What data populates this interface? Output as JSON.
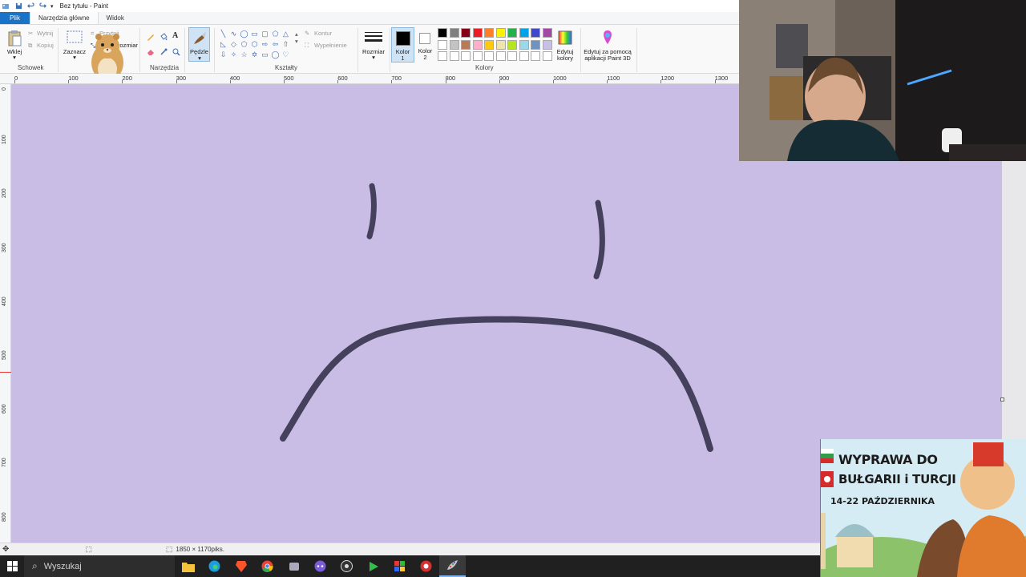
{
  "window": {
    "title": "Bez tytułu - Paint"
  },
  "menu": {
    "file": "Plik",
    "tabs": [
      "Narzędzia główne",
      "Widok"
    ]
  },
  "ribbon": {
    "clipboard": {
      "paste": "Wklej",
      "cut": "Wytnij",
      "copy": "Kopiuj",
      "group": "Schowek"
    },
    "image": {
      "select": "Zaznacz",
      "crop": "Przytnij",
      "resize": "Zmień rozmiar",
      "rotate": "Obróć"
    },
    "tools": {
      "group": "Narzędzia"
    },
    "brushes": {
      "label": "Pędzle"
    },
    "shapes": {
      "outline": "Kontur",
      "fill": "Wypełnienie",
      "group": "Kształty"
    },
    "size": {
      "label": "Rozmiar"
    },
    "colors": {
      "color1_line1": "Kolor",
      "color1_line2": "1",
      "color2_line1": "Kolor",
      "color2_line2": "2",
      "edit_line1": "Edytuj",
      "edit_line2": "kolory",
      "paint3d_line1": "Edytuj za pomocą",
      "paint3d_line2": "aplikacji Paint 3D",
      "group": "Kolory",
      "palette_row1": [
        "#000000",
        "#7f7f7f",
        "#880015",
        "#ed1c24",
        "#ff7f27",
        "#fff200",
        "#22b14c",
        "#00a2e8",
        "#3f48cc",
        "#a349a4"
      ],
      "palette_row2": [
        "#ffffff",
        "#c3c3c3",
        "#b97a57",
        "#ffaec9",
        "#ffc90e",
        "#efe4b0",
        "#b5e61d",
        "#99d9ea",
        "#7092be",
        "#c8bfe7"
      ],
      "palette_row3": [
        "#ffffff",
        "#ffffff",
        "#ffffff",
        "#ffffff",
        "#ffffff",
        "#ffffff",
        "#ffffff",
        "#ffffff",
        "#ffffff",
        "#ffffff"
      ]
    }
  },
  "ruler": {
    "h_ticks": [
      "0",
      "100",
      "200",
      "300",
      "400",
      "500",
      "600",
      "700",
      "800",
      "900",
      "1000",
      "1100",
      "1200",
      "1300"
    ],
    "v_ticks": [
      "0",
      "100",
      "200",
      "300",
      "400",
      "500",
      "600",
      "700",
      "800"
    ]
  },
  "canvas": {
    "background": "#c9bde6",
    "stroke_color": "#3a3650"
  },
  "status": {
    "dimensions": "1850 × 1170piks."
  },
  "taskbar": {
    "search_placeholder": "Wyszukaj"
  },
  "promo": {
    "line1": "WYPRAWA DO",
    "line2": "BUŁGARII i TURCJI",
    "dates": "14-22 PAŹDZIERNIKA"
  }
}
